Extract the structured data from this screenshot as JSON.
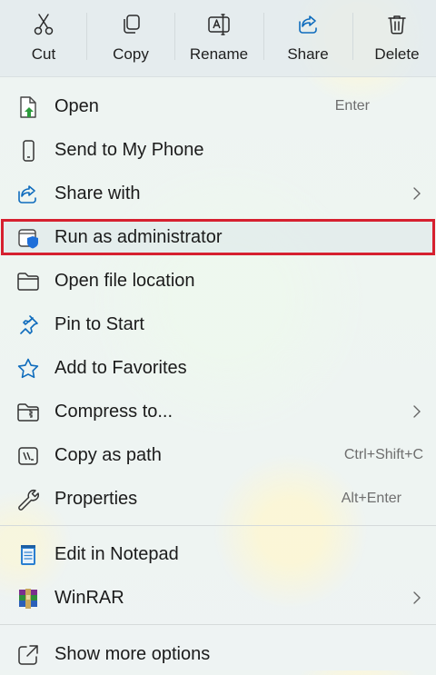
{
  "toolbar": {
    "cut": {
      "label": "Cut",
      "icon": "scissors-icon"
    },
    "copy": {
      "label": "Copy",
      "icon": "copy-icon"
    },
    "rename": {
      "label": "Rename",
      "icon": "rename-icon"
    },
    "share": {
      "label": "Share",
      "icon": "share-icon"
    },
    "delete": {
      "label": "Delete",
      "icon": "trash-icon"
    }
  },
  "menu": {
    "items": [
      {
        "label": "Open",
        "shortcut": "Enter",
        "icon": "open-file-icon"
      },
      {
        "label": "Send to My Phone",
        "shortcut": "",
        "icon": "phone-icon"
      },
      {
        "label": "Share with",
        "shortcut": "",
        "icon": "share-with-icon",
        "submenu": true
      },
      {
        "label": "Run as administrator",
        "shortcut": "",
        "icon": "shield-icon",
        "highlighted": true
      },
      {
        "label": "Open file location",
        "shortcut": "",
        "icon": "folder-icon"
      },
      {
        "label": "Pin to Start",
        "shortcut": "",
        "icon": "pin-icon"
      },
      {
        "label": "Add to Favorites",
        "shortcut": "",
        "icon": "star-icon"
      },
      {
        "label": "Compress to...",
        "shortcut": "",
        "icon": "zip-folder-icon",
        "submenu": true
      },
      {
        "label": "Copy as path",
        "shortcut": "Ctrl+Shift+C",
        "icon": "copy-path-icon"
      },
      {
        "label": "Properties",
        "shortcut": "Alt+Enter",
        "icon": "wrench-icon"
      },
      {
        "label": "Edit in Notepad",
        "shortcut": "",
        "icon": "notepad-icon"
      },
      {
        "label": "WinRAR",
        "shortcut": "",
        "icon": "winrar-icon",
        "submenu": true
      },
      {
        "label": "Show more options",
        "shortcut": "",
        "icon": "show-more-icon"
      }
    ]
  },
  "colors": {
    "accent": "#0f6cbd",
    "highlight_border": "#d6202f"
  }
}
